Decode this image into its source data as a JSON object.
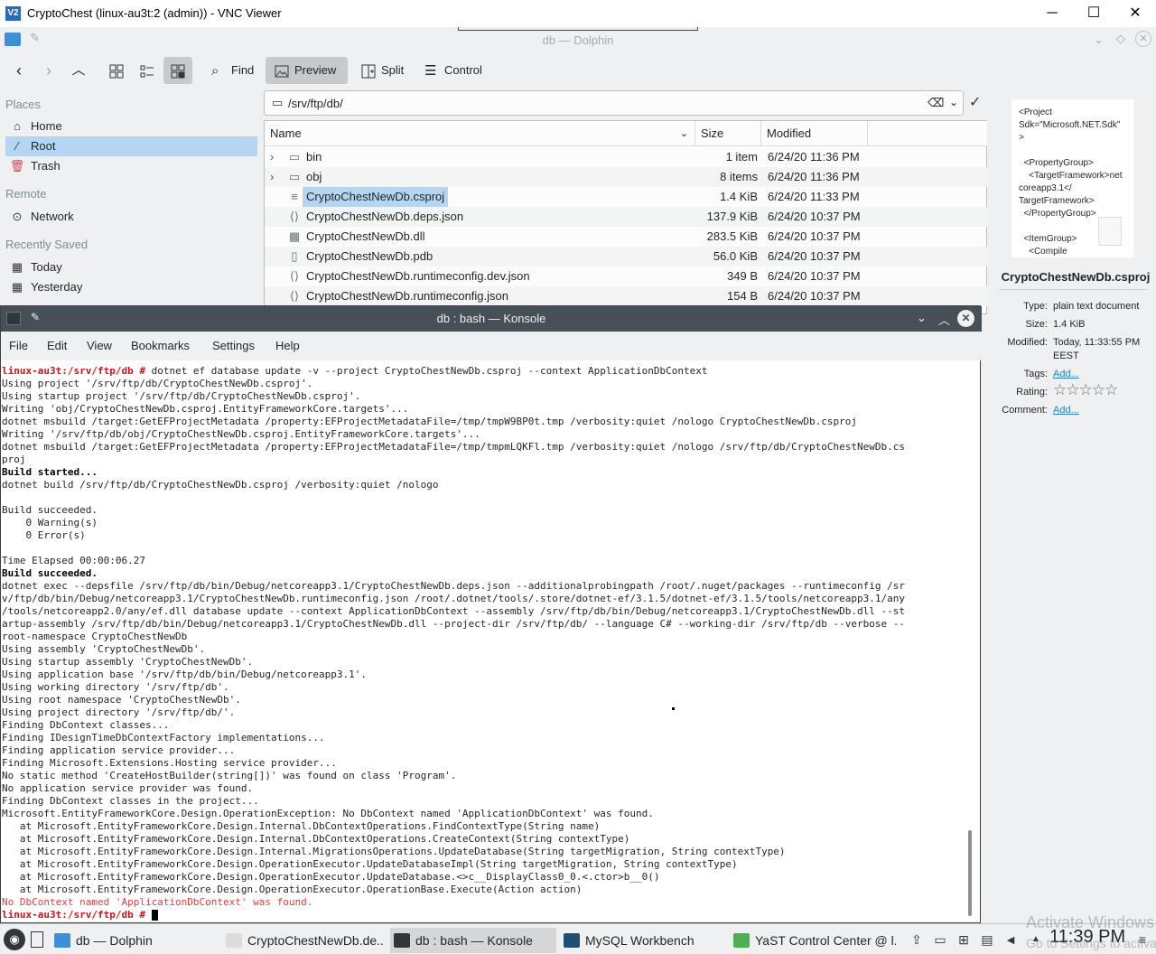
{
  "vnc": {
    "title": "CryptoChest (linux-au3t:2 (admin)) - VNC Viewer",
    "logo": "V2",
    "minimize": "─",
    "maximize": "☐",
    "close": "✕"
  },
  "dolphin": {
    "window_title": "db — Dolphin",
    "toolbar": {
      "find": "Find",
      "preview": "Preview",
      "split": "Split",
      "control": "Control"
    },
    "places": {
      "head_places": "Places",
      "home": "Home",
      "root": "Root",
      "trash": "Trash",
      "head_remote": "Remote",
      "network": "Network",
      "head_recent": "Recently Saved",
      "today": "Today",
      "yesterday": "Yesterday"
    },
    "location": "/srv/ftp/db/",
    "columns": {
      "name": "Name",
      "size": "Size",
      "modified": "Modified"
    },
    "files": [
      {
        "name": "bin",
        "size": "1 item",
        "modified": "6/24/20 11:36 PM",
        "icon": "folder-icon"
      },
      {
        "name": "obj",
        "size": "8 items",
        "modified": "6/24/20 11:36 PM",
        "icon": "folder-icon"
      },
      {
        "name": "CryptoChestNewDb.csproj",
        "size": "1.4 KiB",
        "modified": "6/24/20 11:33 PM",
        "icon": "text-file-icon"
      },
      {
        "name": "CryptoChestNewDb.deps.json",
        "size": "137.9 KiB",
        "modified": "6/24/20 10:37 PM",
        "icon": "json-file-icon"
      },
      {
        "name": "CryptoChestNewDb.dll",
        "size": "283.5 KiB",
        "modified": "6/24/20 10:37 PM",
        "icon": "binary-file-icon"
      },
      {
        "name": "CryptoChestNewDb.pdb",
        "size": "56.0 KiB",
        "modified": "6/24/20 10:37 PM",
        "icon": "file-icon"
      },
      {
        "name": "CryptoChestNewDb.runtimeconfig.dev.json",
        "size": "349 B",
        "modified": "6/24/20 10:37 PM",
        "icon": "json-file-icon"
      },
      {
        "name": "CryptoChestNewDb.runtimeconfig.json",
        "size": "154 B",
        "modified": "6/24/20 10:37 PM",
        "icon": "json-file-icon"
      }
    ],
    "info": {
      "preview_text": "<Project\nSdk=\"Microsoft.NET.Sdk\"\n>\n\n  <PropertyGroup>\n    <TargetFramework>net\ncoreapp3.1</\nTargetFramework>\n  </PropertyGroup>\n\n  <ItemGroup>\n    <Compile",
      "filename": "CryptoChestNewDb.csproj",
      "type_label": "Type:",
      "type_value": "plain text document",
      "size_label": "Size:",
      "size_value": "1.4 KiB",
      "modified_label": "Modified:",
      "modified_value": "Today, 11:33:55 PM",
      "modified_tz": "EEST",
      "tags_label": "Tags:",
      "tags_link": "Add...",
      "rating_label": "Rating:",
      "rating_stars": "☆☆☆☆☆",
      "comment_label": "Comment:",
      "comment_link": "Add..."
    }
  },
  "konsole": {
    "window_title": "db : bash — Konsole",
    "menu": [
      "File",
      "Edit",
      "View",
      "Bookmarks",
      "Settings",
      "Help"
    ],
    "prompt": "linux-au3t:/srv/ftp/db #",
    "command": " dotnet ef database update -v --project CryptoChestNewDb.csproj --context ApplicationDbContext",
    "lines": [
      "Using project '/srv/ftp/db/CryptoChestNewDb.csproj'.",
      "Using startup project '/srv/ftp/db/CryptoChestNewDb.csproj'.",
      "Writing 'obj/CryptoChestNewDb.csproj.EntityFrameworkCore.targets'...",
      "dotnet msbuild /target:GetEFProjectMetadata /property:EFProjectMetadataFile=/tmp/tmpW9BP0t.tmp /verbosity:quiet /nologo CryptoChestNewDb.csproj",
      "Writing '/srv/ftp/db/obj/CryptoChestNewDb.csproj.EntityFrameworkCore.targets'...",
      "dotnet msbuild /target:GetEFProjectMetadata /property:EFProjectMetadataFile=/tmp/tmpmLQKFl.tmp /verbosity:quiet /nologo /srv/ftp/db/CryptoChestNewDb.cs",
      "proj"
    ],
    "build_started": "Build started...",
    "build_cmd": "dotnet build /srv/ftp/db/CryptoChestNewDb.csproj /verbosity:quiet /nologo",
    "build_succeeded_1": "Build succeeded.",
    "warnings": "    0 Warning(s)",
    "errors": "    0 Error(s)",
    "elapsed": "Time Elapsed 00:00:06.27",
    "build_succeeded_2": "Build succeeded.",
    "exec_lines": [
      "dotnet exec --depsfile /srv/ftp/db/bin/Debug/netcoreapp3.1/CryptoChestNewDb.deps.json --additionalprobingpath /root/.nuget/packages --runtimeconfig /sr",
      "v/ftp/db/bin/Debug/netcoreapp3.1/CryptoChestNewDb.runtimeconfig.json /root/.dotnet/tools/.store/dotnet-ef/3.1.5/dotnet-ef/3.1.5/tools/netcoreapp3.1/any",
      "/tools/netcoreapp2.0/any/ef.dll database update --context ApplicationDbContext --assembly /srv/ftp/db/bin/Debug/netcoreapp3.1/CryptoChestNewDb.dll --st",
      "artup-assembly /srv/ftp/db/bin/Debug/netcoreapp3.1/CryptoChestNewDb.dll --project-dir /srv/ftp/db/ --language C# --working-dir /srv/ftp/db --verbose --",
      "root-namespace CryptoChestNewDb",
      "Using assembly 'CryptoChestNewDb'.",
      "Using startup assembly 'CryptoChestNewDb'.",
      "Using application base '/srv/ftp/db/bin/Debug/netcoreapp3.1'.",
      "Using working directory '/srv/ftp/db'.",
      "Using root namespace 'CryptoChestNewDb'.",
      "Using project directory '/srv/ftp/db/'.",
      "Finding DbContext classes...",
      "Finding IDesignTimeDbContextFactory implementations...",
      "Finding application service provider...",
      "Finding Microsoft.Extensions.Hosting service provider...",
      "No static method 'CreateHostBuilder(string[])' was found on class 'Program'.",
      "No application service provider was found.",
      "Finding DbContext classes in the project...",
      "Microsoft.EntityFrameworkCore.Design.OperationException: No DbContext named 'ApplicationDbContext' was found.",
      "   at Microsoft.EntityFrameworkCore.Design.Internal.DbContextOperations.FindContextType(String name)",
      "   at Microsoft.EntityFrameworkCore.Design.Internal.DbContextOperations.CreateContext(String contextType)",
      "   at Microsoft.EntityFrameworkCore.Design.Internal.MigrationsOperations.UpdateDatabase(String targetMigration, String contextType)",
      "   at Microsoft.EntityFrameworkCore.Design.OperationExecutor.UpdateDatabaseImpl(String targetMigration, String contextType)",
      "   at Microsoft.EntityFrameworkCore.Design.OperationExecutor.UpdateDatabase.<>c__DisplayClass0_0.<.ctor>b__0()",
      "   at Microsoft.EntityFrameworkCore.Design.OperationExecutor.OperationBase.Execute(Action action)"
    ],
    "error_line": "No DbContext named 'ApplicationDbContext' was found.",
    "final_prompt": "linux-au3t:/srv/ftp/db #"
  },
  "taskbar": {
    "tasks": [
      {
        "label": "db — Dolphin",
        "color": "#3d8fd6"
      },
      {
        "label": "CryptoChestNewDb.de...",
        "color": "#dcdcdc"
      },
      {
        "label": "db : bash — Konsole",
        "color": "#31363b"
      },
      {
        "label": "MySQL Workbench",
        "color": "#1f4e79"
      },
      {
        "label": "YaST Control Center @ l...",
        "color": "#4caf50"
      }
    ],
    "clock": "11:39 PM",
    "watermark": "Activate Windows",
    "watermark2": "Go to Settings to activate"
  },
  "colors": {
    "selection": "#b6d5f2",
    "konsole_title": "#475057",
    "prompt_red": "#c8161d",
    "error_red": "#e04040",
    "link": "#2980b9"
  }
}
